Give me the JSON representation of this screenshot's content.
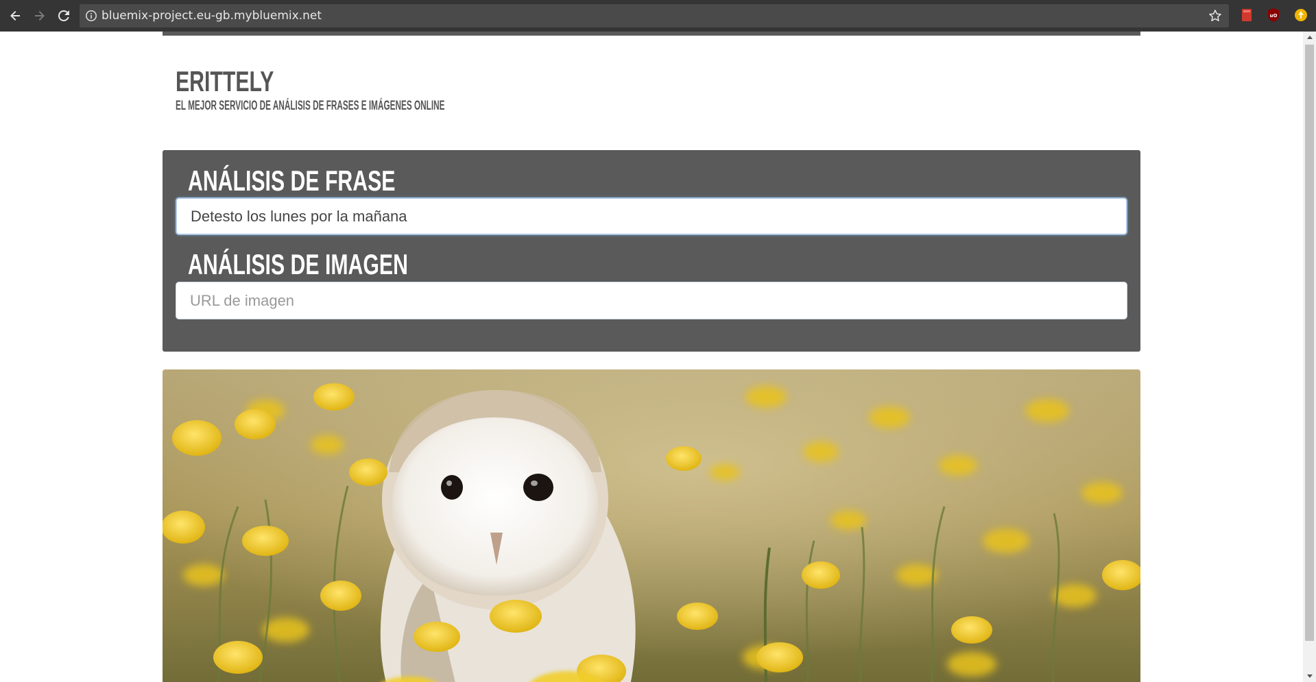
{
  "browser": {
    "url": "bluemix-project.eu-gb.mybluemix.net"
  },
  "site": {
    "title": "ERITTELY",
    "subtitle": "EL MEJOR SERVICIO DE ANÁLISIS DE FRASES E IMÁGENES ONLINE"
  },
  "phrase_section": {
    "title": "ANÁLISIS DE FRASE",
    "input_value": "Detesto los lunes por la mañana",
    "input_placeholder": ""
  },
  "image_section": {
    "title": "ANÁLISIS DE IMAGEN",
    "input_value": "",
    "input_placeholder": "URL de imagen"
  },
  "colors": {
    "panel": "#5a5a5a",
    "brand_text": "#555555",
    "chrome": "#353535"
  },
  "icons": [
    "back-icon",
    "forward-icon",
    "reload-icon",
    "info-icon",
    "star-icon",
    "bookmark-extension-icon",
    "ublock-icon",
    "extension-icon"
  ]
}
